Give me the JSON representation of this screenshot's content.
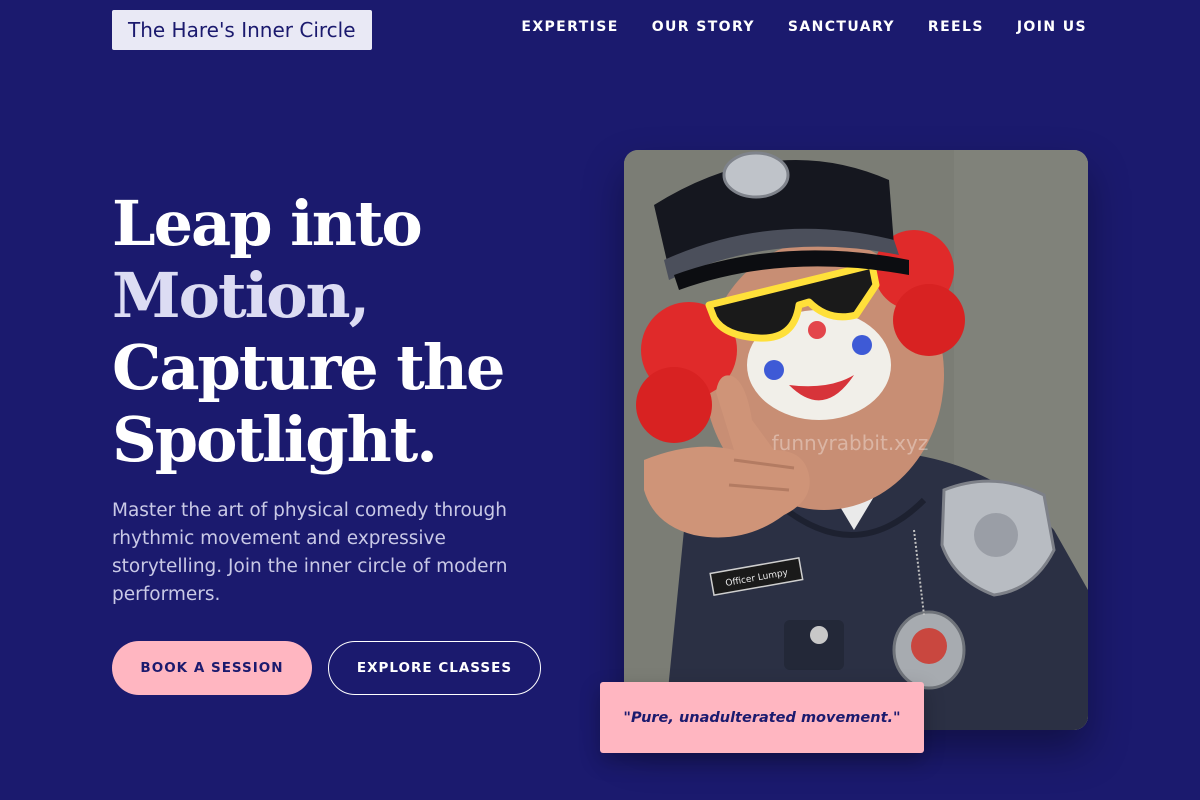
{
  "brand": {
    "name": "The Hare's Inner Circle"
  },
  "nav": {
    "links": [
      "EXPERTISE",
      "OUR STORY",
      "SANCTUARY",
      "REELS",
      "JOIN US"
    ]
  },
  "hero": {
    "title_lines": [
      "Leap into",
      "Motion,",
      "Capture the",
      "Spotlight."
    ],
    "description": "Master the art of physical comedy through rhythmic movement and expressive storytelling. Join the inner circle of modern performers.",
    "primary_cta": "BOOK A SESSION",
    "secondary_cta": "EXPLORE CLASSES"
  },
  "photo": {
    "watermark": "funnyrabbit.xyz",
    "name_tag": "Officer Lumpy"
  },
  "quote": {
    "text": "\"Pure, unadulterated movement.\""
  },
  "colors": {
    "background": "#1b1a6e",
    "accent_pink": "#ffb6c1",
    "logo_bg": "#e9e9f5"
  }
}
